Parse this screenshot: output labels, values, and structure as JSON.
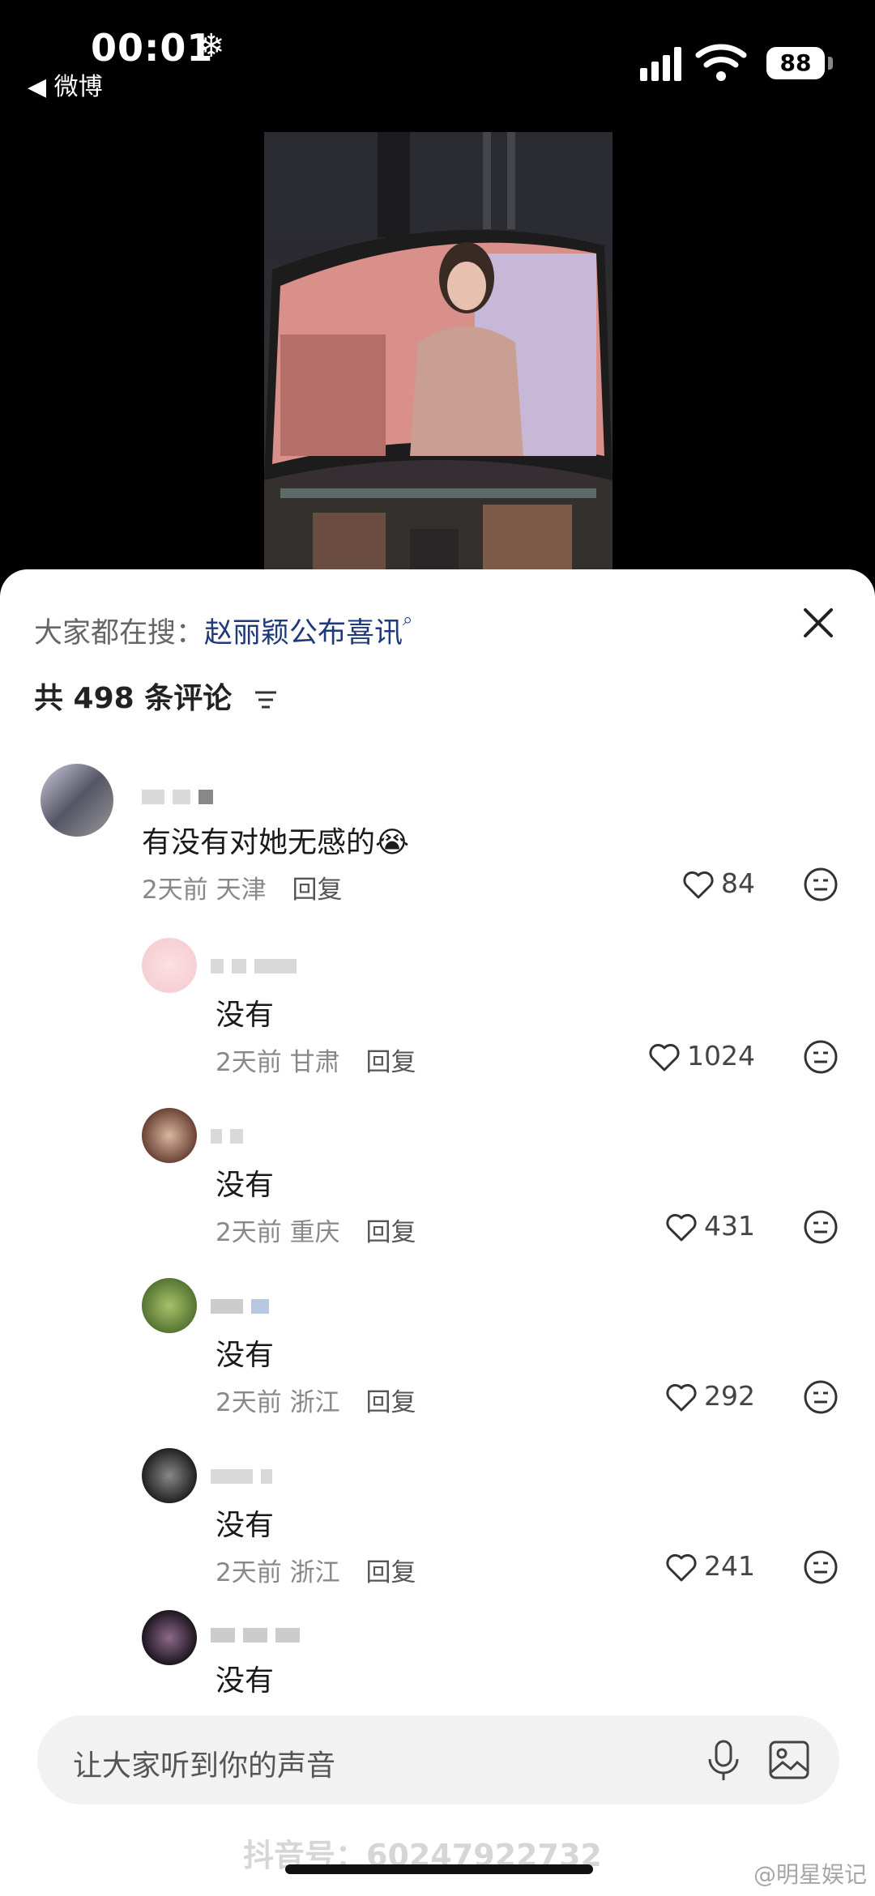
{
  "status_bar": {
    "time": "00:01",
    "back_label": "◀ 微博",
    "battery": "88"
  },
  "panel": {
    "search_prefix": "大家都在搜：",
    "search_term": "赵丽颖公布喜讯",
    "comment_count": "共 498 条评论"
  },
  "comments": [
    {
      "text": "有没有对她无感的😭",
      "time": "2天前",
      "location": "天津",
      "reply": "回复",
      "likes": "84"
    },
    {
      "text": "没有",
      "time": "2天前",
      "location": "甘肃",
      "reply": "回复",
      "likes": "1024"
    },
    {
      "text": "没有",
      "time": "2天前",
      "location": "重庆",
      "reply": "回复",
      "likes": "431"
    },
    {
      "text": "没有",
      "time": "2天前",
      "location": "浙江",
      "reply": "回复",
      "likes": "292"
    },
    {
      "text": "没有",
      "time": "2天前",
      "location": "浙江",
      "reply": "回复",
      "likes": "241"
    },
    {
      "text": "没有"
    }
  ],
  "input": {
    "placeholder": "让大家听到你的声音"
  },
  "watermarks": {
    "douyin": "抖音号：60247922732",
    "weibo": "@明星娱记"
  },
  "colors": {
    "search_term": "#1f3a7a",
    "panel_bg": "#ffffff",
    "input_bg": "#f2f2f3"
  }
}
